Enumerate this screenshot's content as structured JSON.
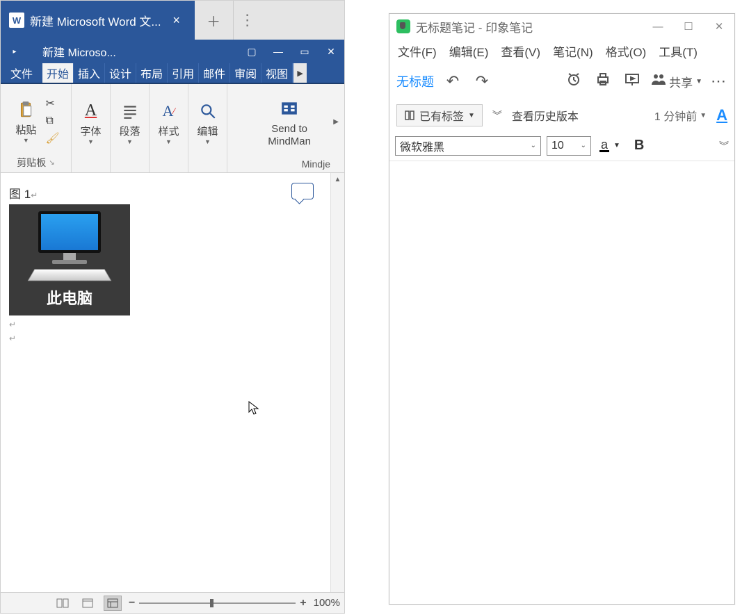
{
  "word": {
    "tab_title": "新建 Microsoft Word 文...",
    "window_title": "新建 Microso...",
    "ribbon": {
      "file": "文件",
      "tabs": [
        "开始",
        "插入",
        "设计",
        "布局",
        "引用",
        "邮件",
        "审阅",
        "视图"
      ],
      "active_tab_index": 0
    },
    "groups": {
      "clipboard": {
        "paste": "粘贴",
        "label": "剪贴板"
      },
      "font": {
        "btn": "字体"
      },
      "paragraph": {
        "btn": "段落"
      },
      "styles": {
        "btn": "样式"
      },
      "editing": {
        "btn": "编辑"
      },
      "mindman": {
        "btn": "Send to MindMan",
        "label": "Mindje"
      }
    },
    "doc": {
      "caption": "图 1",
      "image_label": "此电脑"
    },
    "status": {
      "zoom": "100%"
    }
  },
  "evernote": {
    "title": "无标题笔记 - 印象笔记",
    "menu": [
      "文件(F)",
      "编辑(E)",
      "查看(V)",
      "笔记(N)",
      "格式(O)",
      "工具(T)"
    ],
    "note_title_short": "无标题",
    "share": "共享",
    "tag_btn": "已有标签",
    "history": "查看历史版本",
    "timestamp": "1 分钟前",
    "font_name": "微软雅黑",
    "font_size": "10",
    "color_letter": "a",
    "bold": "B"
  }
}
